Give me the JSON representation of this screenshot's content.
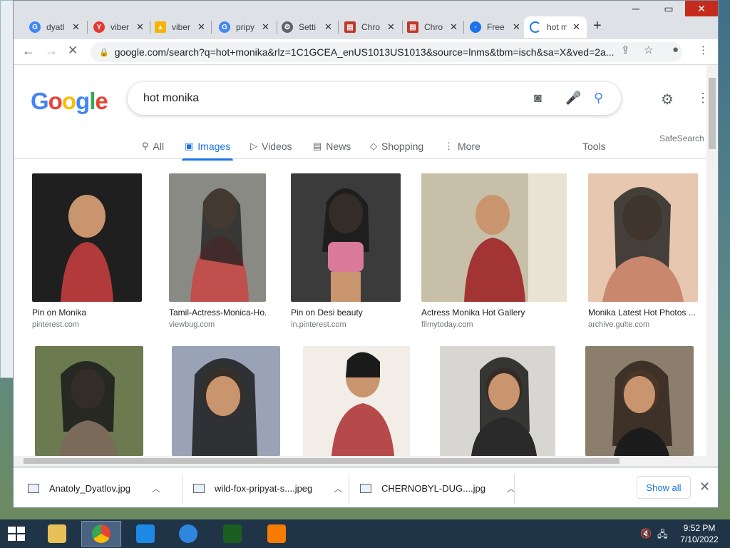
{
  "browser": {
    "tabs": [
      {
        "label": "dyatl",
        "favicon": "google-g",
        "color": "#4285f4"
      },
      {
        "label": "viber",
        "favicon": "yandex-y",
        "color": "#e53935"
      },
      {
        "label": "viber",
        "favicon": "image-sun",
        "color": "#f4b400"
      },
      {
        "label": "pripy",
        "favicon": "google-g",
        "color": "#4285f4"
      },
      {
        "label": "Setti",
        "favicon": "gear",
        "color": "#5f6368"
      },
      {
        "label": "Chro",
        "favicon": "chrome-doc",
        "color": "#c0392b"
      },
      {
        "label": "Chro",
        "favicon": "chrome-doc",
        "color": "#c0392b"
      },
      {
        "label": "Free",
        "favicon": "page",
        "color": "#1a73e8"
      },
      {
        "label": "hot m",
        "favicon": "loading-spinner",
        "color": "#1a73e8"
      }
    ],
    "url": "google.com/search?q=hot+monika&rlz=1C1GCEA_enUS1013US1013&source=lnms&tbm=isch&sa=X&ved=2a..."
  },
  "google": {
    "logo": "Google",
    "query": "hot monika",
    "nav": [
      {
        "label": "All",
        "icon": "search-icon"
      },
      {
        "label": "Images",
        "icon": "image-icon"
      },
      {
        "label": "Videos",
        "icon": "play-icon"
      },
      {
        "label": "News",
        "icon": "news-icon"
      },
      {
        "label": "Shopping",
        "icon": "tag-icon"
      },
      {
        "label": "More",
        "icon": "dots-icon"
      }
    ],
    "tools": "Tools",
    "safesearch": "SafeSearch"
  },
  "results": [
    {
      "caption": "Pin on Monika",
      "source": "pinterest.com",
      "color": "#b23a3a"
    },
    {
      "caption": "Tamil-Actress-Monica-Ho...",
      "source": "viewbug.com",
      "color": "#c0504d"
    },
    {
      "caption": "Pin on Desi beauty",
      "source": "in.pinterest.com",
      "color": "#d97a9a"
    },
    {
      "caption": "Actress Monika Hot Gallery",
      "source": "filmytoday.com",
      "color": "#a33434"
    },
    {
      "caption": "Monika Latest Hot Photos ...",
      "source": "archive.gulte.com",
      "color": "#c9876e"
    },
    {
      "caption": "",
      "source": "",
      "color": "#7a6a5a"
    },
    {
      "caption": "",
      "source": "",
      "color": "#8a4a4a"
    },
    {
      "caption": "",
      "source": "",
      "color": "#b64a4a"
    },
    {
      "caption": "",
      "source": "",
      "color": "#4a4a4a"
    },
    {
      "caption": "",
      "source": "",
      "color": "#6a5a4a"
    }
  ],
  "downloads": [
    {
      "name": "Anatoly_Dyatlov.jpg"
    },
    {
      "name": "wild-fox-pripyat-s....jpeg"
    },
    {
      "name": "CHERNOBYL-DUG....jpg"
    }
  ],
  "downloads_show_all": "Show all",
  "taskbar": {
    "time": "9:52 PM",
    "date": "7/10/2022"
  }
}
